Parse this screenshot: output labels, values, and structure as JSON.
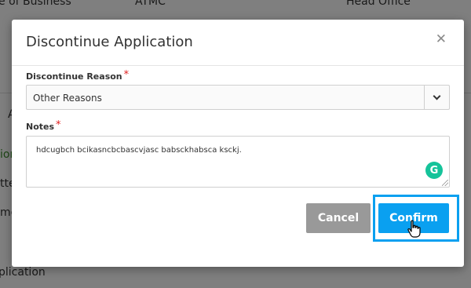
{
  "background": {
    "labels": [
      {
        "text": "e of Business"
      },
      {
        "text": "ATMC"
      },
      {
        "text": "Head Office"
      },
      {
        "text": "A"
      },
      {
        "text": "ion"
      },
      {
        "text": "tte"
      },
      {
        "text": "me"
      },
      {
        "text": "plication"
      }
    ]
  },
  "dialog": {
    "title": "Discontinue Application",
    "close_icon": "close-icon",
    "reason_label": "Discontinue Reason",
    "reason_value": "Other Reasons",
    "notes_label": "Notes",
    "required_mark": "*",
    "notes_value": "hdcugbch bcikasncbcbascvjasc babsckhabsca ksckj.",
    "grammarly_badge": "G",
    "cancel_label": "Cancel",
    "confirm_label": "Confirm"
  },
  "colors": {
    "overlay": "#7f7f7f",
    "confirm": "#0aa0f0",
    "cancel": "#999999",
    "required": "#e02020",
    "grammarly": "#15c39a"
  }
}
